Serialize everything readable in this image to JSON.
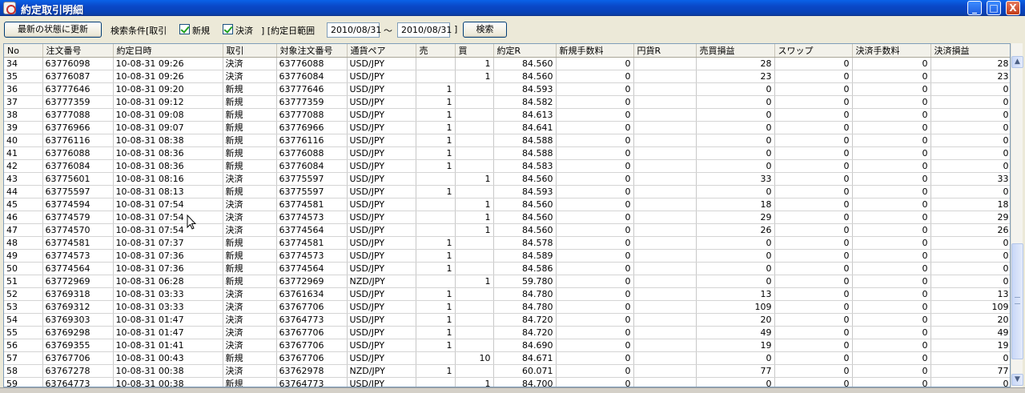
{
  "window": {
    "title": "約定取引明細",
    "controls": {
      "minimize": "_",
      "maximize": "□",
      "close": "X"
    }
  },
  "toolbar": {
    "refresh_label": "最新の状態に更新",
    "filter_label": "検索条件[取引",
    "new_label": "新規",
    "settle_label": "決済",
    "range_label": "] [約定日範囲",
    "date_from": "2010/08/31",
    "tilde": "～",
    "date_to": "2010/08/31",
    "range_close": "]",
    "search_label": "検索"
  },
  "table": {
    "headers": [
      "No",
      "注文番号",
      "約定日時",
      "取引",
      "対象注文番号",
      "通貨ペア",
      "売",
      "買",
      "約定R",
      "新規手数料",
      "円貨R",
      "売買損益",
      "スワップ",
      "決済手数料",
      "決済損益"
    ],
    "rows": [
      [
        "34",
        "63776098",
        "10-08-31 09:26",
        "決済",
        "63776088",
        "USD/JPY",
        "",
        "1",
        "84.560",
        "0",
        "",
        "28",
        "0",
        "0",
        "28"
      ],
      [
        "35",
        "63776087",
        "10-08-31 09:26",
        "決済",
        "63776084",
        "USD/JPY",
        "",
        "1",
        "84.560",
        "0",
        "",
        "23",
        "0",
        "0",
        "23"
      ],
      [
        "36",
        "63777646",
        "10-08-31 09:20",
        "新規",
        "63777646",
        "USD/JPY",
        "1",
        "",
        "84.593",
        "0",
        "",
        "0",
        "0",
        "0",
        "0"
      ],
      [
        "37",
        "63777359",
        "10-08-31 09:12",
        "新規",
        "63777359",
        "USD/JPY",
        "1",
        "",
        "84.582",
        "0",
        "",
        "0",
        "0",
        "0",
        "0"
      ],
      [
        "38",
        "63777088",
        "10-08-31 09:08",
        "新規",
        "63777088",
        "USD/JPY",
        "1",
        "",
        "84.613",
        "0",
        "",
        "0",
        "0",
        "0",
        "0"
      ],
      [
        "39",
        "63776966",
        "10-08-31 09:07",
        "新規",
        "63776966",
        "USD/JPY",
        "1",
        "",
        "84.641",
        "0",
        "",
        "0",
        "0",
        "0",
        "0"
      ],
      [
        "40",
        "63776116",
        "10-08-31 08:38",
        "新規",
        "63776116",
        "USD/JPY",
        "1",
        "",
        "84.588",
        "0",
        "",
        "0",
        "0",
        "0",
        "0"
      ],
      [
        "41",
        "63776088",
        "10-08-31 08:36",
        "新規",
        "63776088",
        "USD/JPY",
        "1",
        "",
        "84.588",
        "0",
        "",
        "0",
        "0",
        "0",
        "0"
      ],
      [
        "42",
        "63776084",
        "10-08-31 08:36",
        "新規",
        "63776084",
        "USD/JPY",
        "1",
        "",
        "84.583",
        "0",
        "",
        "0",
        "0",
        "0",
        "0"
      ],
      [
        "43",
        "63775601",
        "10-08-31 08:16",
        "決済",
        "63775597",
        "USD/JPY",
        "",
        "1",
        "84.560",
        "0",
        "",
        "33",
        "0",
        "0",
        "33"
      ],
      [
        "44",
        "63775597",
        "10-08-31 08:13",
        "新規",
        "63775597",
        "USD/JPY",
        "1",
        "",
        "84.593",
        "0",
        "",
        "0",
        "0",
        "0",
        "0"
      ],
      [
        "45",
        "63774594",
        "10-08-31 07:54",
        "決済",
        "63774581",
        "USD/JPY",
        "",
        "1",
        "84.560",
        "0",
        "",
        "18",
        "0",
        "0",
        "18"
      ],
      [
        "46",
        "63774579",
        "10-08-31 07:54",
        "決済",
        "63774573",
        "USD/JPY",
        "",
        "1",
        "84.560",
        "0",
        "",
        "29",
        "0",
        "0",
        "29"
      ],
      [
        "47",
        "63774570",
        "10-08-31 07:54",
        "決済",
        "63774564",
        "USD/JPY",
        "",
        "1",
        "84.560",
        "0",
        "",
        "26",
        "0",
        "0",
        "26"
      ],
      [
        "48",
        "63774581",
        "10-08-31 07:37",
        "新規",
        "63774581",
        "USD/JPY",
        "1",
        "",
        "84.578",
        "0",
        "",
        "0",
        "0",
        "0",
        "0"
      ],
      [
        "49",
        "63774573",
        "10-08-31 07:36",
        "新規",
        "63774573",
        "USD/JPY",
        "1",
        "",
        "84.589",
        "0",
        "",
        "0",
        "0",
        "0",
        "0"
      ],
      [
        "50",
        "63774564",
        "10-08-31 07:36",
        "新規",
        "63774564",
        "USD/JPY",
        "1",
        "",
        "84.586",
        "0",
        "",
        "0",
        "0",
        "0",
        "0"
      ],
      [
        "51",
        "63772969",
        "10-08-31 06:28",
        "新規",
        "63772969",
        "NZD/JPY",
        "",
        "1",
        "59.780",
        "0",
        "",
        "0",
        "0",
        "0",
        "0"
      ],
      [
        "52",
        "63769318",
        "10-08-31 03:33",
        "決済",
        "63761634",
        "USD/JPY",
        "1",
        "",
        "84.780",
        "0",
        "",
        "13",
        "0",
        "0",
        "13"
      ],
      [
        "53",
        "63769312",
        "10-08-31 03:33",
        "決済",
        "63767706",
        "USD/JPY",
        "1",
        "",
        "84.780",
        "0",
        "",
        "109",
        "0",
        "0",
        "109"
      ],
      [
        "54",
        "63769303",
        "10-08-31 01:47",
        "決済",
        "63764773",
        "USD/JPY",
        "1",
        "",
        "84.720",
        "0",
        "",
        "20",
        "0",
        "0",
        "20"
      ],
      [
        "55",
        "63769298",
        "10-08-31 01:47",
        "決済",
        "63767706",
        "USD/JPY",
        "1",
        "",
        "84.720",
        "0",
        "",
        "49",
        "0",
        "0",
        "49"
      ],
      [
        "56",
        "63769355",
        "10-08-31 01:41",
        "決済",
        "63767706",
        "USD/JPY",
        "1",
        "",
        "84.690",
        "0",
        "",
        "19",
        "0",
        "0",
        "19"
      ],
      [
        "57",
        "63767706",
        "10-08-31 00:43",
        "新規",
        "63767706",
        "USD/JPY",
        "",
        "10",
        "84.671",
        "0",
        "",
        "0",
        "0",
        "0",
        "0"
      ],
      [
        "58",
        "63767278",
        "10-08-31 00:38",
        "決済",
        "63762978",
        "NZD/JPY",
        "1",
        "",
        "60.071",
        "0",
        "",
        "77",
        "0",
        "0",
        "77"
      ],
      [
        "59",
        "63764773",
        "10-08-31 00:38",
        "新規",
        "63764773",
        "USD/JPY",
        "",
        "1",
        "84.700",
        "0",
        "",
        "0",
        "0",
        "0",
        "0"
      ]
    ]
  },
  "scrollbar": {
    "up": "▲",
    "down": "▼"
  }
}
